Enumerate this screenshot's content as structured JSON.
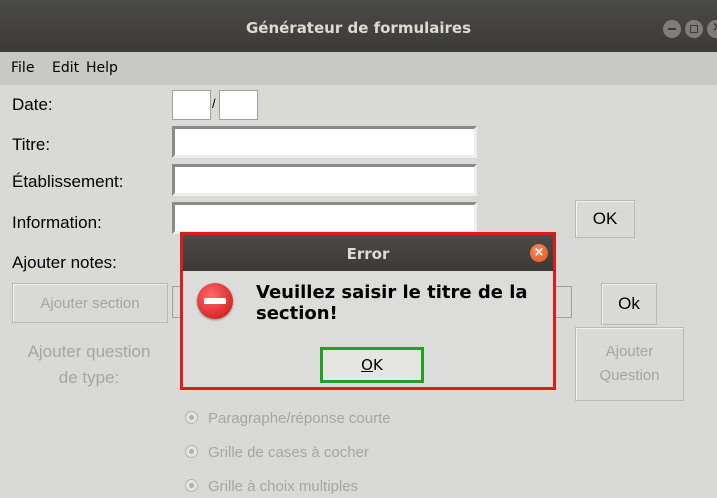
{
  "window": {
    "title": "Générateur de formulaires"
  },
  "menu": {
    "file": "File",
    "edit": "Edit",
    "help": "Help"
  },
  "form": {
    "date_label": "Date:",
    "date_separator": "/",
    "titre_label": "Titre:",
    "etablissement_label": "Établissement:",
    "information_label": "Information:",
    "information_ok": "OK",
    "notes_label": "Ajouter notes:",
    "add_section_button": "Ajouter section",
    "section_ok": "Ok",
    "add_question_label_line1": "Ajouter question",
    "add_question_label_line2": "de type:",
    "add_question_button_line1": "Ajouter",
    "add_question_button_line2": "Question",
    "question_types": [
      "Paragraphe/réponse courte",
      "Grille de cases à cocher",
      "Grille à choix multiples"
    ]
  },
  "dialog": {
    "title": "Error",
    "message": "Veuillez saisir le titre de la section!",
    "ok_mnemonic": "O",
    "ok_rest": "K"
  },
  "icons": {
    "window_minimize": "minimize-icon",
    "window_maximize": "maximize-icon",
    "window_close": "close-icon",
    "dialog_close": "close-icon",
    "dialog_error": "error-icon"
  },
  "colors": {
    "dialog_border": "#e01a1a",
    "ok_focus_border": "#22a022",
    "titlebar": "#3c3b37"
  }
}
